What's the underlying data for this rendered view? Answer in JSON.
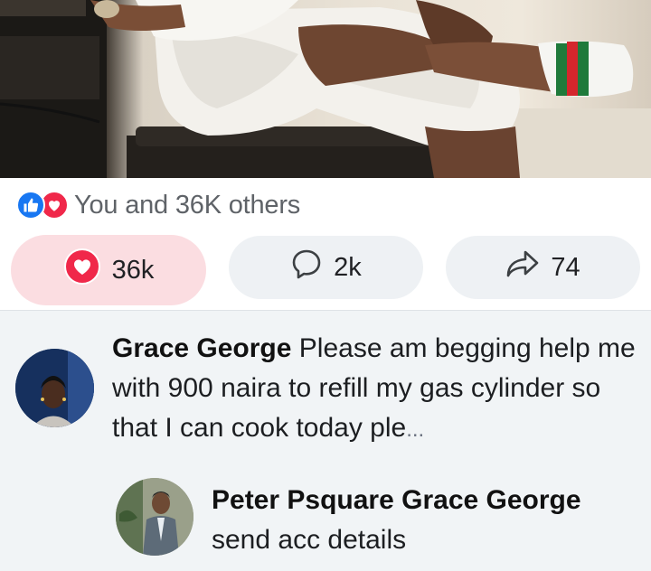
{
  "post": {
    "photo_alt": "",
    "reactions_summary": "You and 36K others",
    "actions": {
      "love_count": "36k",
      "comment_count": "2k",
      "share_count": "74"
    }
  },
  "comments": [
    {
      "author": "Grace George",
      "text": "Please am begging help me with 900 naira to refill my gas cylinder so that I can cook today ple",
      "truncation": "...",
      "replies": [
        {
          "author": "Peter Psquare",
          "mention": "Grace George",
          "text": "send acc details"
        }
      ]
    }
  ],
  "colors": {
    "like_blue": "#1877f2",
    "love_red": "#f0284a",
    "love_pill_bg": "#fbdde1",
    "pill_bg": "#eef1f4",
    "comments_bg": "#f1f4f6"
  }
}
